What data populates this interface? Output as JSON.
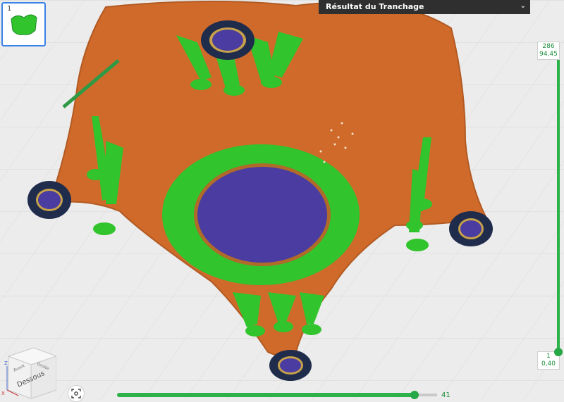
{
  "plate": {
    "number": "1"
  },
  "panel": {
    "title": "Résultat du Tranchage",
    "collapse_icon": "chevron-double-down-icon"
  },
  "layer_slider": {
    "top_layer": "286",
    "top_height": "94,45",
    "bottom_layer": "1",
    "bottom_height": "0,40"
  },
  "progress": {
    "value": "41",
    "fraction": 0.93
  },
  "view_cube": {
    "face": "Dessous",
    "left": "Avant",
    "right": "Droite",
    "axis_z": "Z",
    "axis_x": "X"
  },
  "icons": {
    "camera": "camera-focus-icon"
  },
  "colors": {
    "model": "#cf6a2a",
    "support": "#31c42d",
    "infill": "#4a3ca0",
    "accent": "#27a745"
  }
}
